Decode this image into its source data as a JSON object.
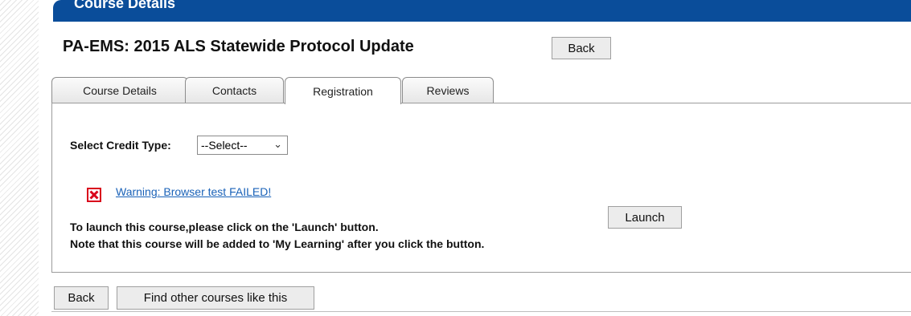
{
  "header": {
    "section_title": "Course Details"
  },
  "course": {
    "title": "PA-EMS: 2015 ALS Statewide Protocol Update",
    "back_label": "Back"
  },
  "tabs": [
    {
      "label": "Course Details",
      "active": false
    },
    {
      "label": "Contacts",
      "active": false
    },
    {
      "label": "Registration",
      "active": true
    },
    {
      "label": "Reviews",
      "active": false
    }
  ],
  "registration": {
    "credit_label": "Select Credit Type:",
    "credit_selected": "--Select--",
    "warning_icon": "red-x-icon",
    "warning_text": "Warning: Browser test FAILED!",
    "launch_text": "To launch this course,please click on the 'Launch' button.",
    "note_text": "Note that this course will be added to 'My Learning' after you click the button.",
    "launch_label": "Launch"
  },
  "footer": {
    "back_label": "Back",
    "find_label": "Find other courses like this"
  },
  "colors": {
    "header_bg": "#0a4d9a",
    "link": "#1a62b8",
    "warning_red": "#d9001b"
  }
}
